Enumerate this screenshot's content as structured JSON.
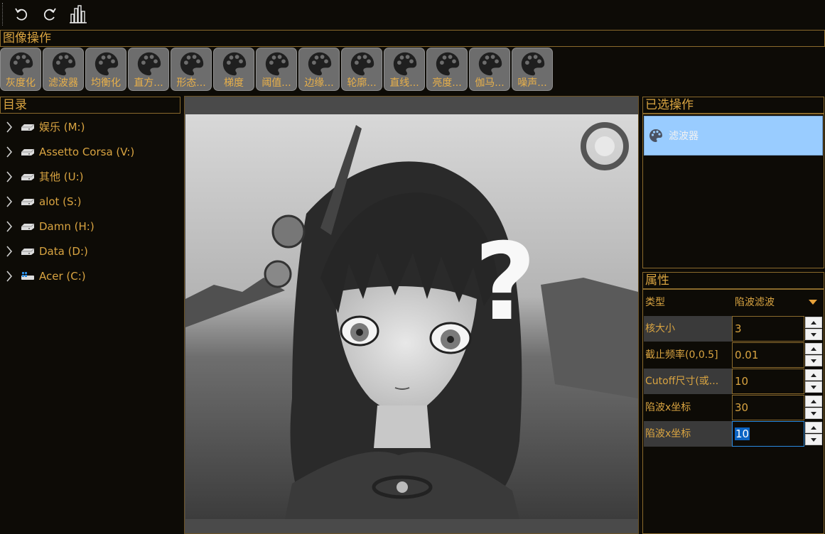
{
  "toolbar": {
    "buttons": [
      {
        "name": "undo-icon"
      },
      {
        "name": "redo-icon"
      },
      {
        "name": "histogram-icon"
      }
    ]
  },
  "image_ops": {
    "title": "图像操作",
    "buttons": [
      "灰度化",
      "滤波器",
      "均衡化",
      "直方...",
      "形态...",
      "梯度",
      "阈值...",
      "边缘...",
      "轮廓...",
      "直线...",
      "亮度...",
      "伽马...",
      "噪声..."
    ],
    "icon": "palette-icon"
  },
  "directory": {
    "title": "目录",
    "items": [
      {
        "label": "娱乐 (M:)",
        "icon": "drive-icon"
      },
      {
        "label": "Assetto Corsa (V:)",
        "icon": "drive-icon"
      },
      {
        "label": "其他 (U:)",
        "icon": "drive-icon"
      },
      {
        "label": "alot (S:)",
        "icon": "drive-icon"
      },
      {
        "label": "Damn (H:)",
        "icon": "drive-icon"
      },
      {
        "label": "Data (D:)",
        "icon": "drive-icon"
      },
      {
        "label": "Acer (C:)",
        "icon": "windows-drive-icon"
      }
    ]
  },
  "selected_ops": {
    "title": "已选操作",
    "items": [
      {
        "label": "滤波器",
        "icon": "palette-icon"
      }
    ]
  },
  "properties": {
    "title": "属性",
    "type_label": "类型",
    "type_value": "陷波滤波",
    "rows": [
      {
        "key": "核大小",
        "value": "3"
      },
      {
        "key": "截止频率(0,0.5]",
        "value": "0.01"
      },
      {
        "key": "Cutoff尺寸(或...",
        "value": "10"
      },
      {
        "key": "陷波x坐标",
        "value": "30"
      },
      {
        "key": "陷波x坐标",
        "value": "10"
      }
    ]
  },
  "colors": {
    "accent": "#d9a441",
    "background": "#0d0b06",
    "selection": "#99ccff"
  }
}
